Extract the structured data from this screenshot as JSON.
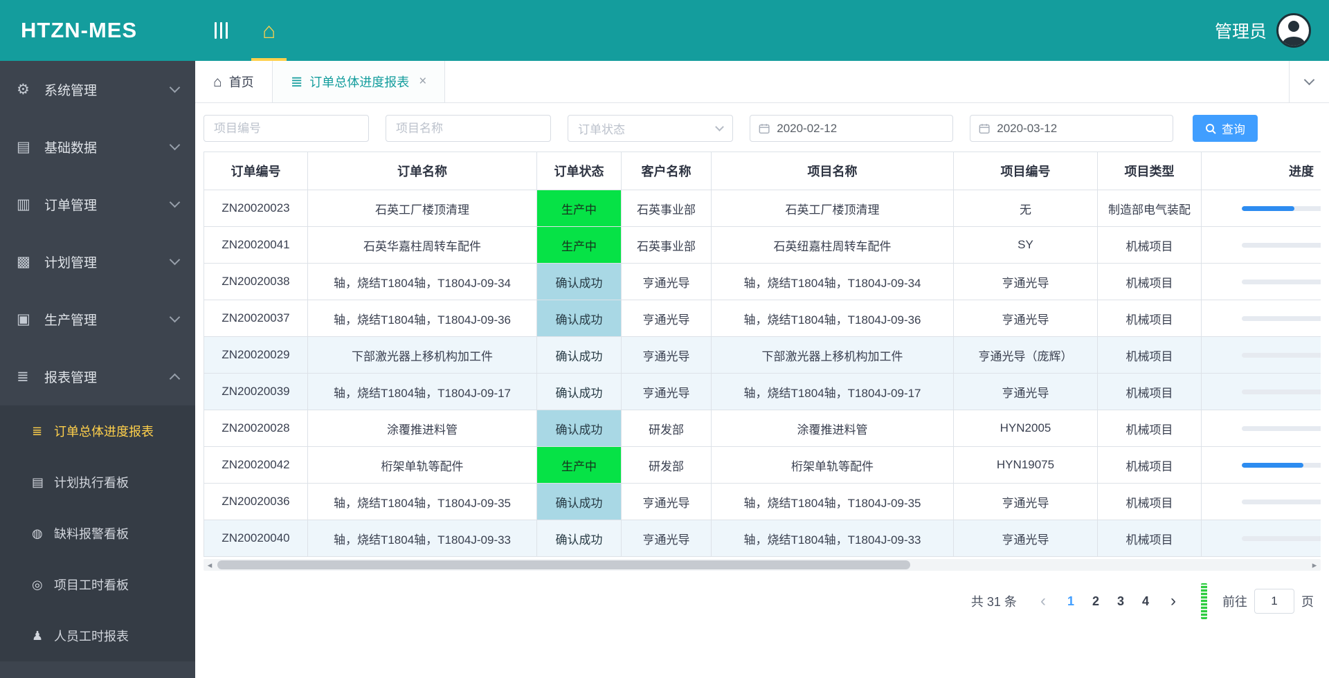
{
  "app": {
    "title": "HTZN-MES",
    "user_name": "管理员"
  },
  "colors": {
    "header_teal": "#149d9d",
    "sidebar_bg": "#3d444e",
    "active_menu_yellow": "#ffd04b",
    "primary_blue": "#409eff",
    "status_green": "#06e246",
    "status_light_blue": "#a9d8e5",
    "progress_blue": "#2d8cf0"
  },
  "icons": {
    "home": "⌂",
    "gear": "⚙",
    "database": "▤",
    "order": "▥",
    "plan": "▩",
    "production": "▣",
    "report": "≣",
    "report-list": "≣",
    "board": "▤",
    "alarm": "◍",
    "clock": "◎",
    "person": "♟",
    "close": "×",
    "prev": "‹",
    "next": "›",
    "scroll_left": "◂",
    "scroll_right": "▸"
  },
  "sidebar": {
    "items": [
      {
        "label": "系统管理",
        "icon": "gear"
      },
      {
        "label": "基础数据",
        "icon": "database"
      },
      {
        "label": "订单管理",
        "icon": "order"
      },
      {
        "label": "计划管理",
        "icon": "plan"
      },
      {
        "label": "生产管理",
        "icon": "production"
      },
      {
        "label": "报表管理",
        "icon": "report",
        "expanded": true
      }
    ],
    "subitems": [
      {
        "label": "订单总体进度报表",
        "icon": "report-list",
        "active": true
      },
      {
        "label": "计划执行看板",
        "icon": "board"
      },
      {
        "label": "缺料报警看板",
        "icon": "alarm"
      },
      {
        "label": "项目工时看板",
        "icon": "clock"
      },
      {
        "label": "人员工时报表",
        "icon": "person"
      }
    ]
  },
  "tabs": [
    {
      "label": "首页",
      "icon": "home"
    },
    {
      "label": "订单总体进度报表",
      "icon": "report",
      "active": true,
      "closable": true
    }
  ],
  "filters": {
    "project_no_placeholder": "项目编号",
    "project_name_placeholder": "项目名称",
    "order_status_placeholder": "订单状态",
    "date_from": "2020-02-12",
    "date_to": "2020-03-12",
    "search_label": "查询"
  },
  "table": {
    "columns": [
      "订单编号",
      "订单名称",
      "订单状态",
      "客户名称",
      "项目名称",
      "项目编号",
      "项目类型",
      "进度"
    ],
    "rows": [
      {
        "order_no": "ZN20020023",
        "order_name": "石英工厂楼顶清理",
        "status": "生产中",
        "status_type": "green",
        "customer": "石英事业部",
        "project_name": "石英工厂楼顶清理",
        "project_no": "无",
        "project_type": "制造部电气装配",
        "progress": 64,
        "highlight": false
      },
      {
        "order_no": "ZN20020041",
        "order_name": "石英华嘉柱周转车配件",
        "status": "生产中",
        "status_type": "green",
        "customer": "石英事业部",
        "project_name": "石英纽嘉柱周转车配件",
        "project_no": "SY",
        "project_type": "机械项目",
        "progress": 0,
        "highlight": false
      },
      {
        "order_no": "ZN20020038",
        "order_name": "轴，烧结T1804轴，T1804J-09-34",
        "status": "确认成功",
        "status_type": "blue",
        "customer": "亨通光导",
        "project_name": "轴，烧结T1804轴，T1804J-09-34",
        "project_no": "亨通光导",
        "project_type": "机械项目",
        "progress": 0,
        "highlight": false
      },
      {
        "order_no": "ZN20020037",
        "order_name": "轴，烧结T1804轴，T1804J-09-36",
        "status": "确认成功",
        "status_type": "blue",
        "customer": "亨通光导",
        "project_name": "轴，烧结T1804轴，T1804J-09-36",
        "project_no": "亨通光导",
        "project_type": "机械项目",
        "progress": 0,
        "highlight": false
      },
      {
        "order_no": "ZN20020029",
        "order_name": "下部激光器上移机构加工件",
        "status": "确认成功",
        "status_type": "blue",
        "customer": "亨通光导",
        "project_name": "下部激光器上移机构加工件",
        "project_no": "亨通光导（庞辉）",
        "project_type": "机械项目",
        "progress": 0,
        "highlight": true
      },
      {
        "order_no": "ZN20020039",
        "order_name": "轴，烧结T1804轴，T1804J-09-17",
        "status": "确认成功",
        "status_type": "blue",
        "customer": "亨通光导",
        "project_name": "轴，烧结T1804轴，T1804J-09-17",
        "project_no": "亨通光导",
        "project_type": "机械项目",
        "progress": 0,
        "highlight": true
      },
      {
        "order_no": "ZN20020028",
        "order_name": "涂覆推进料管",
        "status": "确认成功",
        "status_type": "blue",
        "customer": "研发部",
        "project_name": "涂覆推进料管",
        "project_no": "HYN2005",
        "project_type": "机械项目",
        "progress": 0,
        "highlight": false
      },
      {
        "order_no": "ZN20020042",
        "order_name": "桁架单轨等配件",
        "status": "生产中",
        "status_type": "green",
        "customer": "研发部",
        "project_name": "桁架单轨等配件",
        "project_no": "HYN19075",
        "project_type": "机械项目",
        "progress": 75,
        "highlight": false
      },
      {
        "order_no": "ZN20020036",
        "order_name": "轴，烧结T1804轴，T1804J-09-35",
        "status": "确认成功",
        "status_type": "blue",
        "customer": "亨通光导",
        "project_name": "轴，烧结T1804轴，T1804J-09-35",
        "project_no": "亨通光导",
        "project_type": "机械项目",
        "progress": 0,
        "highlight": false
      },
      {
        "order_no": "ZN20020040",
        "order_name": "轴，烧结T1804轴，T1804J-09-33",
        "status": "确认成功",
        "status_type": "blue",
        "customer": "亨通光导",
        "project_name": "轴，烧结T1804轴，T1804J-09-33",
        "project_no": "亨通光导",
        "project_type": "机械项目",
        "progress": 0,
        "highlight": true
      }
    ]
  },
  "pagination": {
    "total_text": "共 31 条",
    "pages": [
      "1",
      "2",
      "3",
      "4"
    ],
    "active_page": "1",
    "goto_label": "前往",
    "goto_value": "1",
    "unit_label": "页"
  }
}
